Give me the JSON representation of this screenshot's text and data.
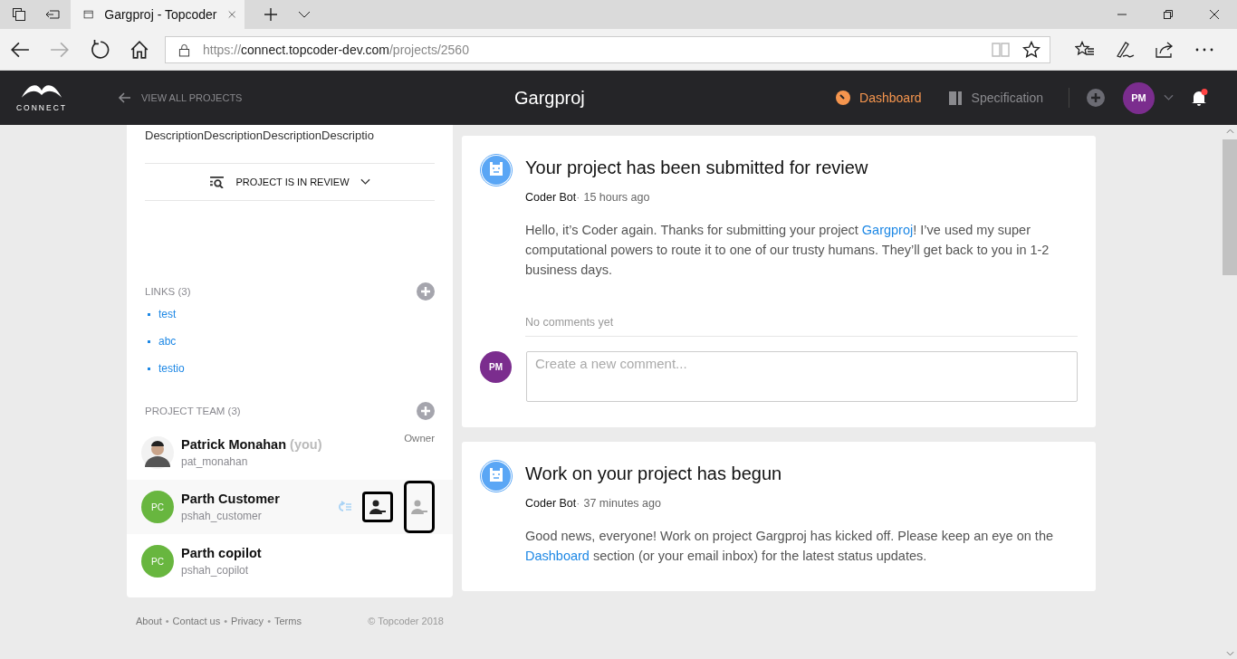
{
  "browser": {
    "tab_title": "Gargproj - Topcoder",
    "url_scheme": "https://",
    "url_host": "connect.topcoder-dev.com",
    "url_path": "/projects/2560"
  },
  "header": {
    "logo_text": "CONNECT",
    "back_link": "VIEW ALL PROJECTS",
    "title": "Gargproj",
    "nav": [
      {
        "label": "Dashboard",
        "selected": true
      },
      {
        "label": "Specification",
        "selected": false
      }
    ],
    "user_initials": "PM",
    "has_notifications": true
  },
  "sidebar": {
    "description": "DescriptionDescriptionDescriptionDescriptio",
    "status": "PROJECT IS IN REVIEW",
    "links": {
      "heading": "LINKS (3)",
      "items": [
        "test",
        "abc",
        "testio"
      ]
    },
    "team": {
      "heading": "PROJECT TEAM (3)",
      "members": [
        {
          "name": "Patrick Monahan",
          "you": "(you)",
          "handle": "pat_monahan",
          "role": "Owner",
          "kind": "photo",
          "hovered": false
        },
        {
          "name": "Parth Customer",
          "handle": "pshah_customer",
          "initials": "PC",
          "kind": "initials",
          "hovered": true
        },
        {
          "name": "Parth copilot",
          "handle": "pshah_copilot",
          "initials": "PC",
          "kind": "initials",
          "hovered": false
        }
      ]
    }
  },
  "footer": {
    "links": [
      "About",
      "Contact us",
      "Privacy",
      "Terms"
    ],
    "separator": "•",
    "copyright": "© Topcoder 2018"
  },
  "feed": [
    {
      "title": "Your project has been submitted for review",
      "author": "Coder Bot",
      "separator": "·",
      "time": "15 hours ago",
      "body": [
        {
          "text": "Hello, it’s Coder again. Thanks for submitting your project "
        },
        {
          "text": "Gargproj",
          "link": true
        },
        {
          "text": "! I’ve used my super computational powers to route it to one of our trusty humans. They’ll get back to you in 1-2 business days."
        }
      ],
      "comments_note": "No comments yet",
      "comment_placeholder": "Create a new comment...",
      "commenter_initials": "PM"
    },
    {
      "title": "Work on your project has begun",
      "author": "Coder Bot",
      "separator": "·",
      "time": "37 minutes ago",
      "body": [
        {
          "text": "Good news, everyone! Work on project Gargproj has kicked off. Please keep an eye on the "
        },
        {
          "text": "Dashboard",
          "link": true
        },
        {
          "text": " section (or your email inbox) for the latest status updates."
        }
      ]
    }
  ]
}
